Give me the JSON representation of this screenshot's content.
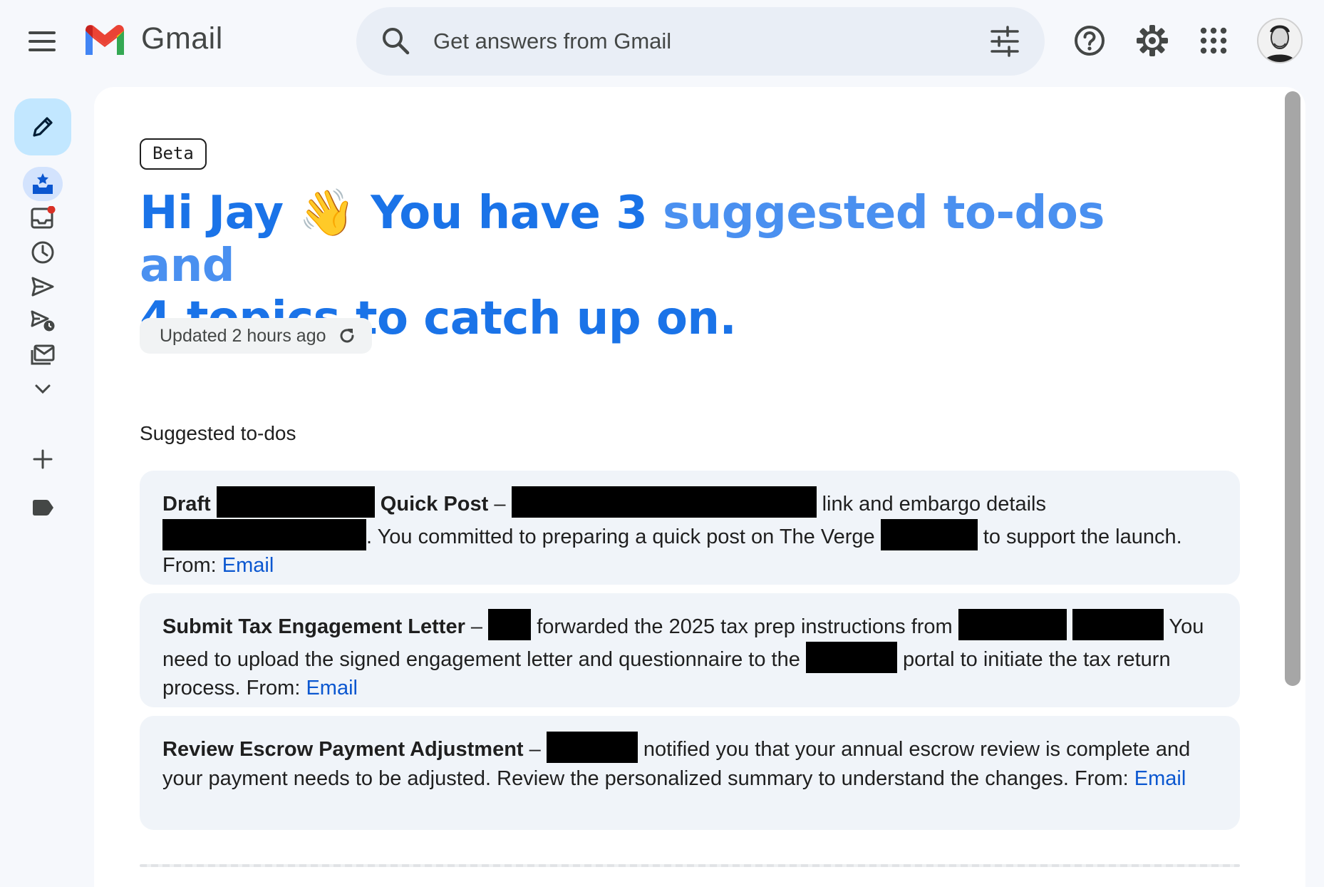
{
  "app": {
    "name": "Gmail"
  },
  "search": {
    "placeholder": "Get answers from Gmail"
  },
  "page": {
    "badge": "Beta",
    "greeting": "Hi Jay",
    "wave_emoji": "👋",
    "headline_part1": "You have 3",
    "headline_part2": "suggested to-dos and",
    "headline_part3": "4 topics to catch up on.",
    "updated_text": "Updated 2 hours ago",
    "section_title": "Suggested to-dos"
  },
  "todos": [
    {
      "title_part1": "Draft",
      "title_part2": "Quick Post",
      "text_a": "link and embargo details",
      "text_b": ". You committed to preparing a quick post on The Verge",
      "text_c": "to support the launch. From:",
      "source": "Email"
    },
    {
      "title": "Submit Tax Engagement Letter",
      "text_a": "forwarded the 2025 tax prep instructions from",
      "text_b": "You need to upload the signed engagement letter and questionnaire to the",
      "text_c": "portal to initiate the tax return process. From:",
      "source": "Email"
    },
    {
      "title": "Review Escrow Payment Adjustment",
      "text_a": "notified you that your annual escrow review is complete and your payment needs to be adjusted. Review the personalized summary to understand the changes. From:",
      "source": "Email"
    }
  ],
  "icons": {
    "menu": "menu-icon",
    "search": "search-icon",
    "filter": "tune-icon",
    "help": "help-icon",
    "settings": "gear-icon",
    "apps": "apps-grid-icon",
    "compose": "pencil-icon",
    "rail": [
      "inbox-star-icon",
      "inbox-icon",
      "clock-icon",
      "send-icon",
      "scheduled-send-icon",
      "all-mail-icon",
      "chevron-down-icon",
      "plus-icon",
      "label-icon"
    ]
  },
  "colors": {
    "accent": "#1a73e8",
    "link": "#0b57d0",
    "compose_bg": "#c2e7ff",
    "card_bg": "#f0f4f9",
    "unread_dot": "#d93025"
  }
}
